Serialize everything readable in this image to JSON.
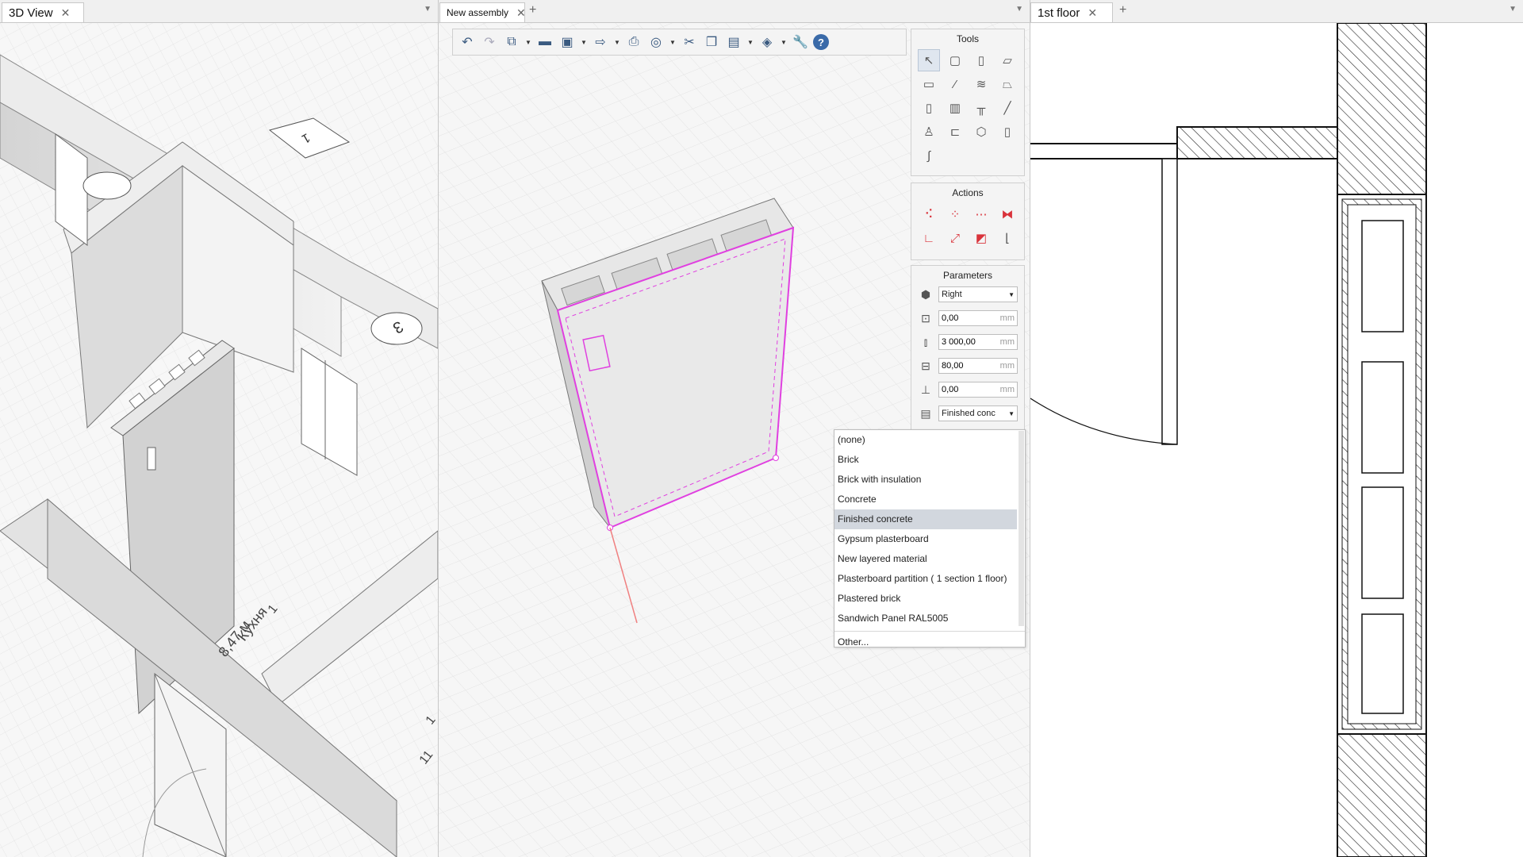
{
  "panes": {
    "view3d": {
      "tab": "3D View",
      "close": "✕",
      "labels": {
        "marker1": "1",
        "marker3": "3",
        "room_num": "1",
        "room_name": "Кухня",
        "room_area": "8,47 м",
        "edge_a": "1",
        "edge_b": "11"
      }
    },
    "assembly": {
      "tab": "New assembly",
      "close": "✕",
      "plus": "+"
    },
    "floor": {
      "tab": "1st floor",
      "close": "✕",
      "plus": "+"
    }
  },
  "toolbar": {
    "icons": [
      "undo-icon",
      "redo-icon",
      "cube-view-icon",
      "open-folder-icon",
      "save-icon",
      "export-icon",
      "print-icon",
      "render-icon",
      "cut-icon",
      "copy-icon",
      "paste-icon",
      "layers-icon",
      "settings-wrench-icon",
      "help-icon"
    ],
    "help_label": "?"
  },
  "tools": {
    "title": "Tools",
    "items": [
      "select-pointer-icon",
      "wall-rect-icon",
      "column-icon",
      "slab-icon",
      "floor-icon",
      "beam-icon",
      "stairs-icon",
      "roof-icon",
      "door-icon",
      "window-icon",
      "railing-icon",
      "line-icon",
      "object-icon",
      "profile-icon",
      "mesh-icon",
      "opening-icon",
      "spline-icon"
    ]
  },
  "actions": {
    "title": "Actions",
    "items": [
      "move-points-icon",
      "rotate-points-icon",
      "array-icon",
      "mirror-icon",
      "angle-icon",
      "scale-icon",
      "extrude-icon",
      "align-icon"
    ]
  },
  "parameters": {
    "title": "Parameters",
    "side_value": "Right",
    "fields": [
      {
        "icon": "offset-icon",
        "value": "0,00",
        "unit": "mm"
      },
      {
        "icon": "height-icon",
        "value": "3 000,00",
        "unit": "mm"
      },
      {
        "icon": "thickness-icon",
        "value": "80,00",
        "unit": "mm"
      },
      {
        "icon": "elevation-icon",
        "value": "0,00",
        "unit": "mm"
      }
    ],
    "material_value": "Finished conc"
  },
  "material_dropdown": {
    "options": [
      "(none)",
      "Brick",
      "Brick with insulation",
      "Concrete",
      "Finished concrete",
      "Gypsum plasterboard",
      "New layered material",
      "Plasterboard partition ( 1 section 1 floor)",
      "Plastered brick",
      "Sandwich Panel RAL5005"
    ],
    "highlighted": "Finished concrete",
    "other": "Other..."
  },
  "colors": {
    "selection": "#e040e0",
    "accent": "#3a6aa8",
    "highlight": "#d2d7de"
  }
}
